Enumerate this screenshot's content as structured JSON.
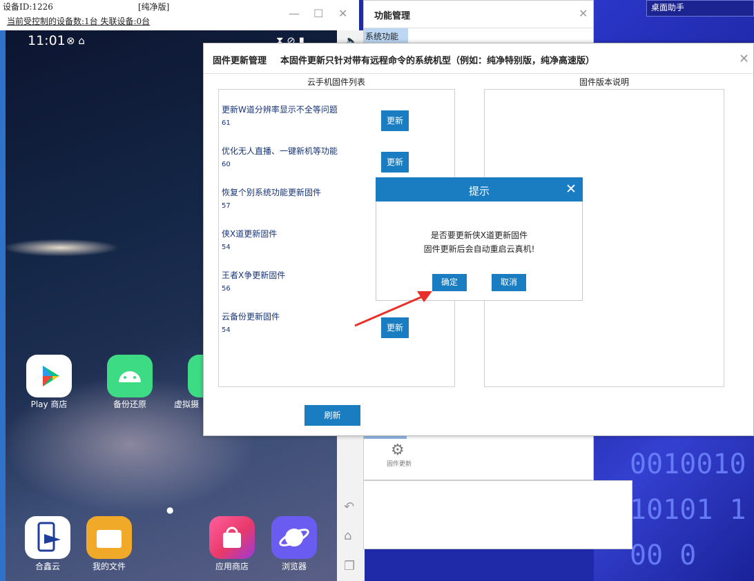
{
  "background": {
    "desktop_button": "桌面助手",
    "binary_text": [
      "0010010",
      "10101 1",
      "00 0"
    ]
  },
  "phone_window": {
    "device_id": "设备ID:1226",
    "edition": "[纯净版]",
    "control_info": "当前受控制的设备数:1台 失联设备:0台",
    "minimize_icon": "—",
    "maximize_icon": "☐",
    "close_icon": "✕",
    "status_time": "11:01",
    "status_icons": "⊗ ⌂",
    "status_right": "⧗ ⊘ ▮",
    "apps": [
      {
        "label": "Play 商店",
        "color": "#ffffff"
      },
      {
        "label": "备份还原",
        "color": "#3ddc84"
      },
      {
        "label": "虚拟摄",
        "color": "#3ddc84"
      }
    ],
    "dock": [
      {
        "label": "合鑫云",
        "color": "#ffffff"
      },
      {
        "label": "我的文件",
        "color": "#f0a928"
      },
      {
        "label": "应用商店",
        "color": "#e83a6a"
      },
      {
        "label": "浏览器",
        "color": "#6a5cf0"
      }
    ],
    "page_dot": "●"
  },
  "side_toolbar": {
    "volume_icon": "🔈",
    "back_icon": "↶",
    "home_icon": "⌂",
    "recent_icon": "❐"
  },
  "function_panel": {
    "title": "功能管理",
    "close_icon": "✕",
    "tab": "系统功能",
    "gear_icon": "⚙",
    "gear_label": "固件更新"
  },
  "firmware_dialog": {
    "title": "固件更新管理",
    "subtitle": "本固件更新只针对带有远程命令的系统机型（例如：纯净特别版，纯净高速版）",
    "close_icon": "✕",
    "list_header": "云手机固件列表",
    "notes_header": "固件版本说明",
    "items": [
      {
        "name": "更新W道分辨率显示不全等问题",
        "version": "61",
        "button": "更新"
      },
      {
        "name": "优化无人直播、一键新机等功能",
        "version": "60",
        "button": "更新"
      },
      {
        "name": "恢复个别系统功能更新固件",
        "version": "57",
        "button": ""
      },
      {
        "name": "侠X道更新固件",
        "version": "54",
        "button": ""
      },
      {
        "name": "王者X争更新固件",
        "version": "56",
        "button": ""
      },
      {
        "name": "云备份更新固件",
        "version": "54",
        "button": "更新"
      }
    ],
    "refresh": "刷新"
  },
  "prompt": {
    "title": "提示",
    "close_icon": "✕",
    "line1": "是否要更新侠X道更新固件",
    "line2": "固件更新后会自动重启云真机!",
    "ok": "确定",
    "cancel": "取消"
  },
  "colors": {
    "accent": "#1a7cc1",
    "arrow": "#e8302a",
    "desktop_bg": "#2a36c8"
  }
}
